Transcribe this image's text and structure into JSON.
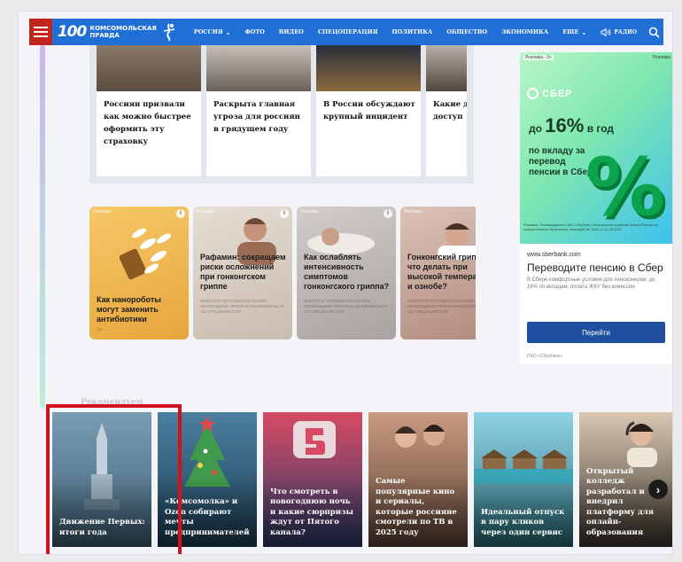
{
  "header": {
    "logo_number": "100",
    "logo_line1": "комсомольская",
    "logo_line2": "правда",
    "nav": [
      {
        "label": "РОССИЯ",
        "chevron": true
      },
      {
        "label": "ФОТО"
      },
      {
        "label": "ВИДЕО"
      },
      {
        "label": "СПЕЦОПЕРАЦИЯ"
      },
      {
        "label": "ПОЛИТИКА"
      },
      {
        "label": "ОБЩЕСТВО"
      },
      {
        "label": "ЭКОНОМИКА"
      },
      {
        "label": "ЕЩЕ",
        "chevron": true
      }
    ],
    "radio_label": "РАДИО"
  },
  "news": [
    {
      "title": "Россиян призвали как можно быстрее оформить эту страховку"
    },
    {
      "title": "Раскрыта главная угроза для россиян в грядущем году"
    },
    {
      "title": "В России обсуждают крупный инцидент"
    },
    {
      "title": "Какие д оказал доступ"
    }
  ],
  "promos": [
    {
      "ad_tag": "Реклама",
      "title": "Как нанороботы могут заменить антибиотики",
      "fine": "18+",
      "bg": "#f2b94a"
    },
    {
      "ad_tag": "Реклама",
      "title": "Рафамин: сокращаем риски осложнений при гонконгском гриппе",
      "fine": "ИМЕЮТСЯ ПРОТИВОПОКАЗАНИЯ. НЕОБХОДИМО ПРОКОНСУЛЬТИРОВАТЬСЯ СО СПЕЦИАЛИСТОМ",
      "bg": "#d8cfc5"
    },
    {
      "ad_tag": "Реклама",
      "title": "Как ослаблять интенсивность симптомов гонконгского гриппа?",
      "fine": "ИМЕЮТСЯ ПРОТИВОПОКАЗАНИЯ. НЕОБХОДИМО ПРОКОНСУЛЬТИРОВАТЬСЯ СО СПЕЦИАЛИСТОМ",
      "bg": "#bdb9b7"
    },
    {
      "ad_tag": "Реклама",
      "title": "Гонконгский грипп: что делать при высокой температуре и ознобе?",
      "fine": "ИМЕЮТСЯ ПРОТИВОПОКАЗАНИЯ. НЕОБХОДИМО ПРОКОНСУЛЬТИРОВАТЬСЯ СО СПЕЦИАЛИСТОМ",
      "bg": "#c9aea3"
    }
  ],
  "ad": {
    "label": "Реклама · 0+",
    "label2": "Реклама",
    "brand": "СБЕР",
    "head_line1": "до",
    "head_big": "16%",
    "head_line1b": "в год",
    "head_rest": "по вкладу за перевод пенсии в Сбер",
    "percent_sign": "%",
    "fine": "Реклама. Рекламодатель ПАО Сбербанк Генеральная лицензия Банка России на осуществление банковских операций № 1481 от 11.08.2015",
    "url": "www.sberbank.com",
    "title": "Переводите пенсию в Сбер",
    "desc": "В Сбере комфортные условия для пенсионеров: до 16% по вкладам, оплата ЖКУ без комиссии",
    "button": "Перейти",
    "org": "ПАО «Сбербанк»"
  },
  "section_heading": "Рекомендуем",
  "stories": [
    {
      "title": "Движение Первых: итоги года",
      "bg1": "#6a8fa6",
      "bg2": "#3f6175"
    },
    {
      "title": "«Комсомолка» и Ozon собирают мечты предпринимателей",
      "bg1": "#3a6e8f",
      "bg2": "#1d3f55"
    },
    {
      "title": "Что смотреть в новогоднюю ночь и какие сюрпризы ждут от Пятого канала?",
      "bg1": "#d84a63",
      "bg2": "#2c3c6b"
    },
    {
      "title": "Самые популярные кино и сериалы, которые россияне смотрели по ТВ в 2025 году",
      "bg1": "#c99a80",
      "bg2": "#5d4335"
    },
    {
      "title": "Идеальный отпуск в пару кликов через один сервис",
      "bg1": "#56b3c7",
      "bg2": "#2a6f7a"
    },
    {
      "title": "Открытый колледж разработал и внедрил платформу для онлайн-образования",
      "bg1": "#b8a38c",
      "bg2": "#3f372f"
    }
  ]
}
